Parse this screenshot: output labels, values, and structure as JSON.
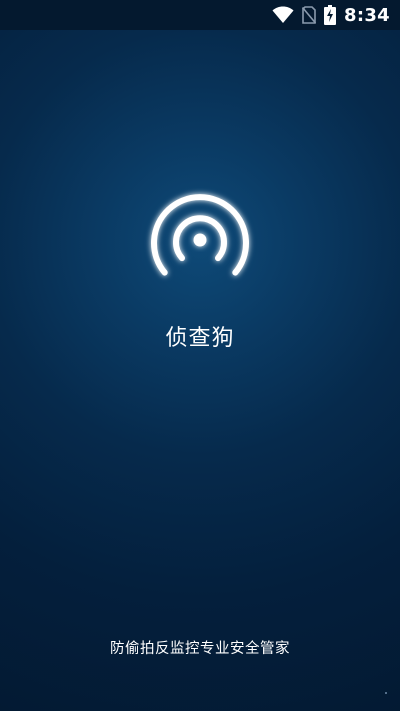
{
  "status_bar": {
    "time": "8:34",
    "icons": [
      "wifi-icon",
      "no-sim-icon",
      "battery-charging-icon"
    ]
  },
  "app": {
    "name": "侦查狗",
    "tagline": "防偷拍反监控专业安全管家",
    "logo_icon": "radar-signal-icon"
  },
  "colors": {
    "background_center": "#0e4a78",
    "background_edge": "#031a33",
    "status_bar": "#04192f",
    "text": "#ffffff",
    "logo_glow": "#7fd8ff"
  }
}
